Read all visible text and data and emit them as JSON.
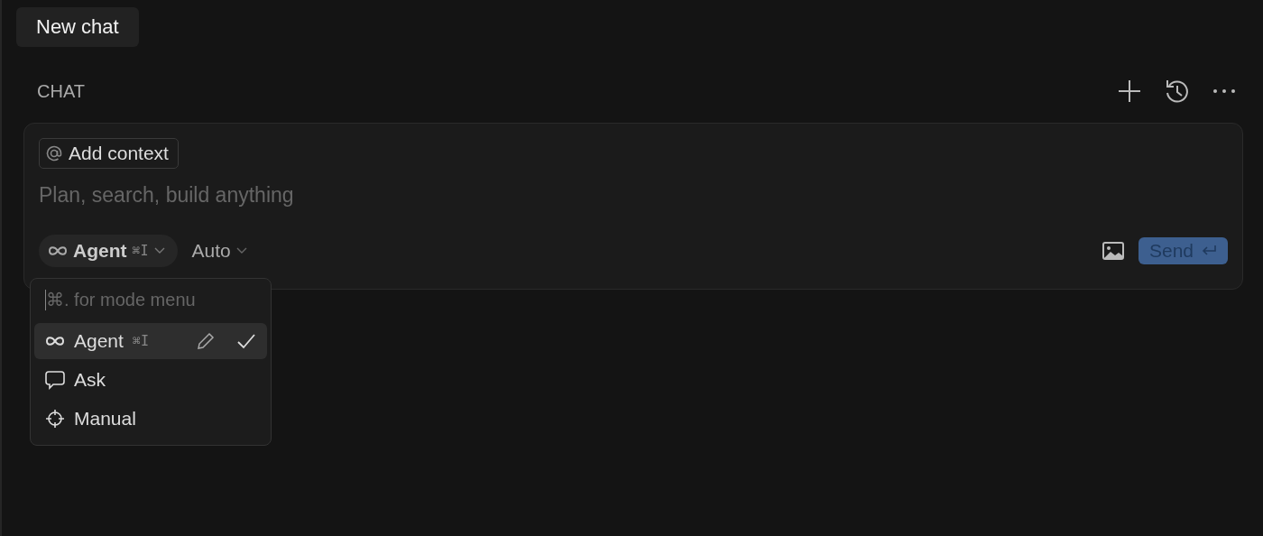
{
  "tab": {
    "label": "New chat",
    "selected": true
  },
  "header": {
    "title": "CHAT"
  },
  "composer": {
    "context_chip": "Add context",
    "placeholder": "Plan, search, build anything",
    "mode": {
      "label": "Agent",
      "shortcut": "⌘I"
    },
    "model": "Auto",
    "send": "Send"
  },
  "mode_menu": {
    "search_placeholder": "⌘. for mode menu",
    "items": [
      {
        "kind": "agent",
        "label": "Agent",
        "shortcut": "⌘I",
        "selected": true
      },
      {
        "kind": "ask",
        "label": "Ask",
        "selected": false
      },
      {
        "kind": "manual",
        "label": "Manual",
        "selected": false
      }
    ]
  }
}
